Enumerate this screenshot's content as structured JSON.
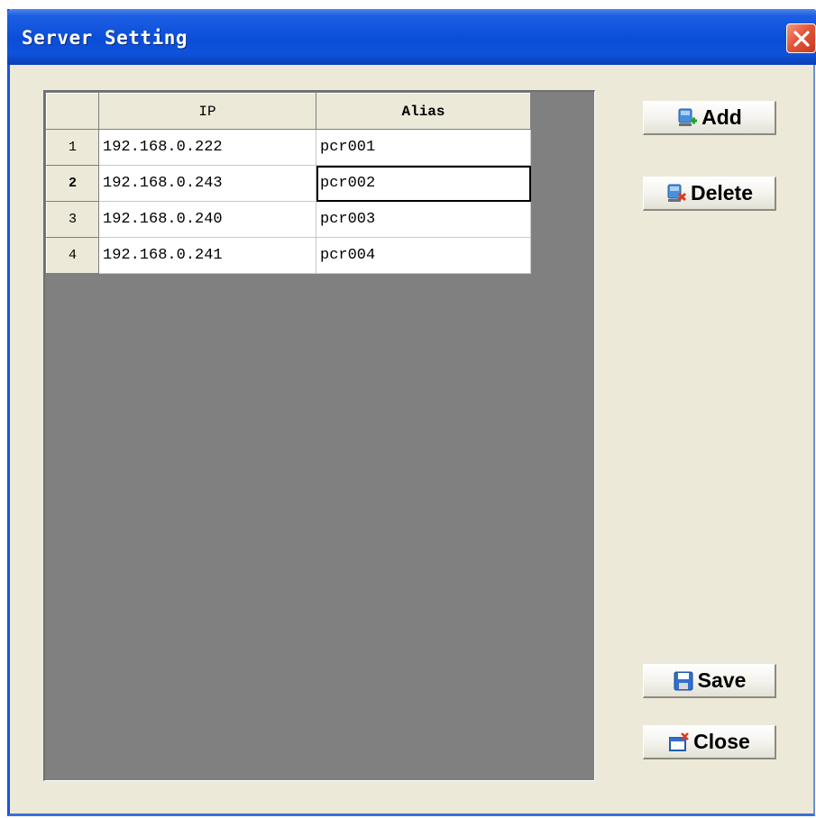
{
  "window": {
    "title": "Server Setting"
  },
  "grid": {
    "columns": [
      "IP",
      "Alias"
    ],
    "rows": [
      {
        "num": "1",
        "ip": "192.168.0.222",
        "alias": "pcr001"
      },
      {
        "num": "2",
        "ip": "192.168.0.243",
        "alias": "pcr002"
      },
      {
        "num": "3",
        "ip": "192.168.0.240",
        "alias": "pcr003"
      },
      {
        "num": "4",
        "ip": "192.168.0.241",
        "alias": "pcr004"
      }
    ]
  },
  "buttons": {
    "add": "Add",
    "delete": "Delete",
    "save": "Save",
    "close": "Close"
  },
  "icons": {
    "add": "server-add-icon",
    "delete": "server-delete-icon",
    "save": "floppy-disk-icon",
    "close": "window-close-icon"
  },
  "colors": {
    "titlebar": "#0a4dd8",
    "dialog_bg": "#ece9d8",
    "grid_bg": "#808080"
  }
}
